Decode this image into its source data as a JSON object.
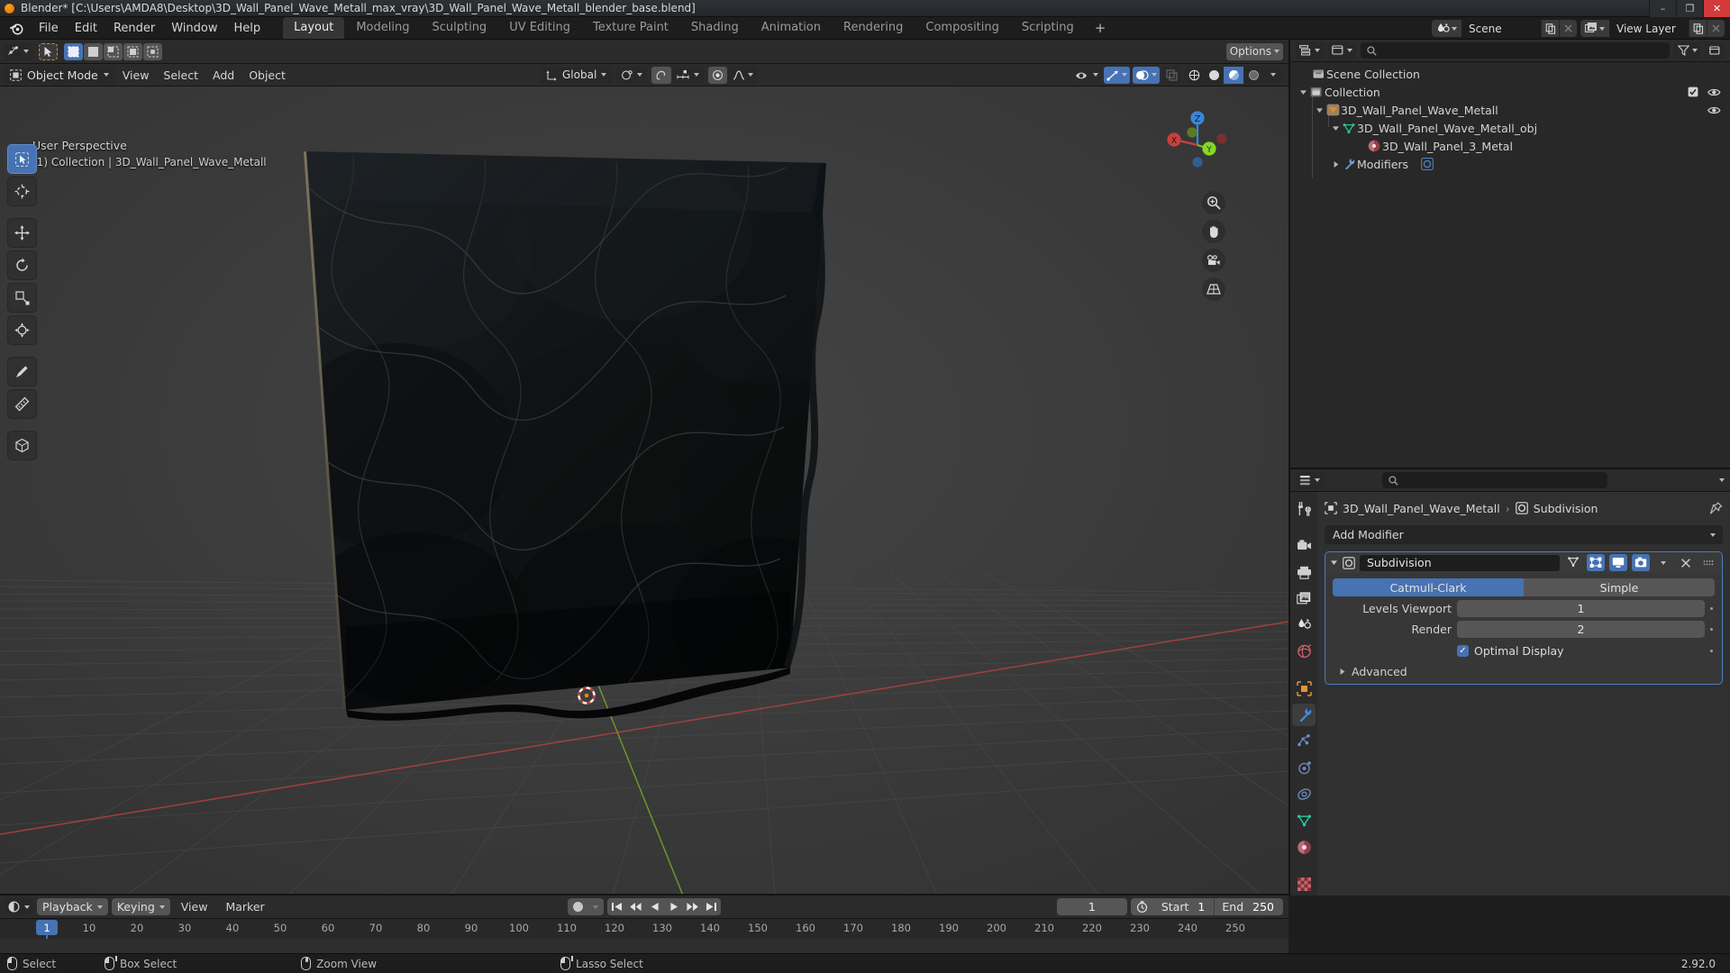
{
  "window": {
    "title": "Blender* [C:\\Users\\AMDA8\\Desktop\\3D_Wall_Panel_Wave_Metall_max_vray\\3D_Wall_Panel_Wave_Metall_blender_base.blend]",
    "minimize": "–",
    "maximize": "❐",
    "close": "✕"
  },
  "menu": {
    "items": [
      "File",
      "Edit",
      "Render",
      "Window",
      "Help"
    ]
  },
  "workspace_tabs": [
    {
      "label": "Layout",
      "active": true
    },
    {
      "label": "Modeling",
      "active": false
    },
    {
      "label": "Sculpting",
      "active": false
    },
    {
      "label": "UV Editing",
      "active": false
    },
    {
      "label": "Texture Paint",
      "active": false
    },
    {
      "label": "Shading",
      "active": false
    },
    {
      "label": "Animation",
      "active": false
    },
    {
      "label": "Rendering",
      "active": false
    },
    {
      "label": "Compositing",
      "active": false
    },
    {
      "label": "Scripting",
      "active": false
    },
    {
      "label": "+",
      "active": false
    }
  ],
  "topbar_right": {
    "scene_name": "Scene",
    "view_layer_name": "View Layer"
  },
  "viewport": {
    "mode": "Object Mode",
    "menus": [
      "View",
      "Select",
      "Add",
      "Object"
    ],
    "transform_orientation": "Global",
    "options_label": "Options",
    "overlay_text_line1": "User Perspective",
    "overlay_text_line2": "(1) Collection | 3D_Wall_Panel_Wave_Metall",
    "gizmo_axes": [
      "X",
      "Y",
      "Z"
    ],
    "tools": [
      "tweak-tool",
      "cursor-tool",
      "move-tool",
      "rotate-tool",
      "scale-tool",
      "transform-tool",
      "annotate-tool",
      "measure-tool",
      "add-cube-tool"
    ]
  },
  "outliner": {
    "search_placeholder": "",
    "rows": [
      {
        "label": "Scene Collection",
        "icon": "collection-icon",
        "indent": 0,
        "expander": "none",
        "eye": false,
        "check": false
      },
      {
        "label": "Collection",
        "icon": "collection-icon",
        "indent": 1,
        "expander": "open",
        "eye": true,
        "check": true
      },
      {
        "label": "3D_Wall_Panel_Wave_Metall",
        "icon": "object-mesh-icon",
        "indent": 2,
        "expander": "open",
        "eye": true,
        "check": false
      },
      {
        "label": "3D_Wall_Panel_Wave_Metall_obj",
        "icon": "mesh-data-icon",
        "indent": 3,
        "expander": "open",
        "eye": false,
        "check": false
      },
      {
        "label": "3D_Wall_Panel_3_Metal",
        "icon": "material-icon",
        "indent": 4,
        "expander": "none",
        "eye": false,
        "check": false
      },
      {
        "label": "Modifiers",
        "icon": "wrench-icon",
        "indent": 3,
        "expander": "closed",
        "eye": false,
        "check": false
      }
    ]
  },
  "properties": {
    "search_placeholder": "",
    "breadcrumb_object": "3D_Wall_Panel_Wave_Metall",
    "breadcrumb_modifier": "Subdivision",
    "add_modifier_label": "Add Modifier",
    "modifier": {
      "name": "Subdivision",
      "type_options": [
        {
          "label": "Catmull-Clark",
          "active": true
        },
        {
          "label": "Simple",
          "active": false
        }
      ],
      "levels_viewport_label": "Levels Viewport",
      "levels_viewport_value": "1",
      "render_label": "Render",
      "render_value": "2",
      "optimal_display_label": "Optimal Display",
      "optimal_display_checked": true,
      "advanced_label": "Advanced"
    },
    "tabs": [
      "tool-tab",
      "render-tab",
      "output-tab",
      "view-layer-tab",
      "scene-tab",
      "world-tab",
      "object-tab",
      "modifier-tab",
      "particles-tab",
      "physics-tab",
      "constraints-tab",
      "data-tab",
      "material-tab",
      "texture-tab"
    ]
  },
  "timeline": {
    "menus": [
      "Playback",
      "Keying",
      "View",
      "Marker"
    ],
    "current_frame": "1",
    "start_label": "Start",
    "start_value": "1",
    "end_label": "End",
    "end_value": "250",
    "ticks": [
      10,
      20,
      30,
      40,
      50,
      60,
      70,
      80,
      90,
      100,
      110,
      120,
      130,
      140,
      150,
      160,
      170,
      180,
      190,
      200,
      210,
      220,
      230,
      240,
      250
    ],
    "playhead_label": "1"
  },
  "statusbar": {
    "items": [
      {
        "icon": "mouse-left-icon",
        "label": "Select"
      },
      {
        "icon": "mouse-left-drag-icon",
        "label": "Box Select"
      },
      {
        "icon": "mouse-middle-icon",
        "label": "Zoom View"
      },
      {
        "icon": "mouse-left-drag-icon",
        "label": "Lasso Select"
      }
    ],
    "version": "2.92.0"
  },
  "colors": {
    "accent_blue": "#4772b3",
    "header_bg": "#2b2b2b",
    "panel_bg": "#303030",
    "viewport_bg": "#393939",
    "axis_x_red": "#c7413f",
    "axis_y_green": "#74c120",
    "axis_z_blue": "#3b86d4"
  }
}
